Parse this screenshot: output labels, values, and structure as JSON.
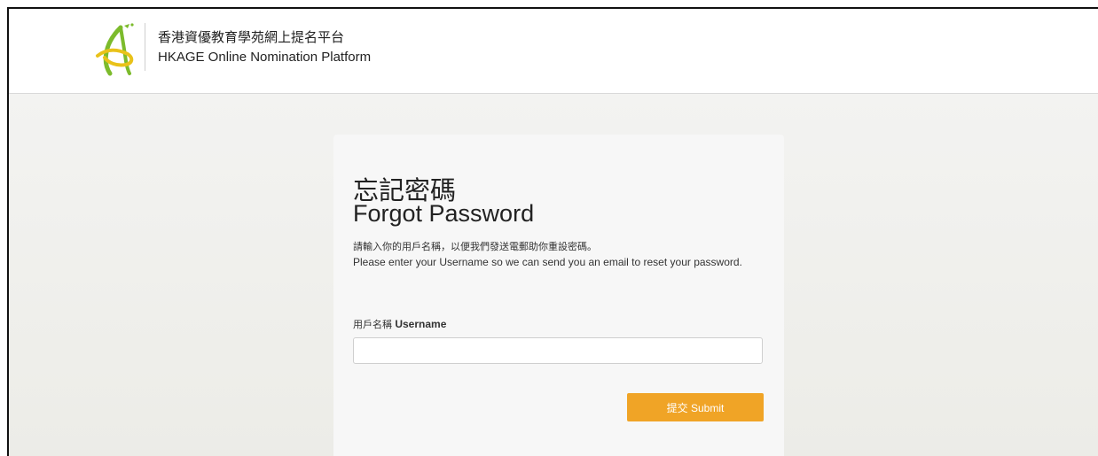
{
  "header": {
    "brand_zh": "香港資優教育學苑網上提名平台",
    "brand_en": "HKAGE Online Nomination Platform",
    "logo_icon": "hkage-logo-icon"
  },
  "form": {
    "title_zh": "忘記密碼",
    "title_en": "Forgot Password",
    "description_zh": "請輸入你的用戶名稱，以便我們發送電郵助你重設密碼。",
    "description_en": "Please enter your Username so we can send you an email to reset your password.",
    "username_label_zh": "用戶名稱",
    "username_label_en": "Username",
    "username_value": "",
    "username_placeholder": "",
    "submit_label": "提交 Submit"
  },
  "colors": {
    "accent": "#f0a426",
    "logo_green": "#7cbb2c",
    "logo_yellow": "#e9c21a"
  }
}
